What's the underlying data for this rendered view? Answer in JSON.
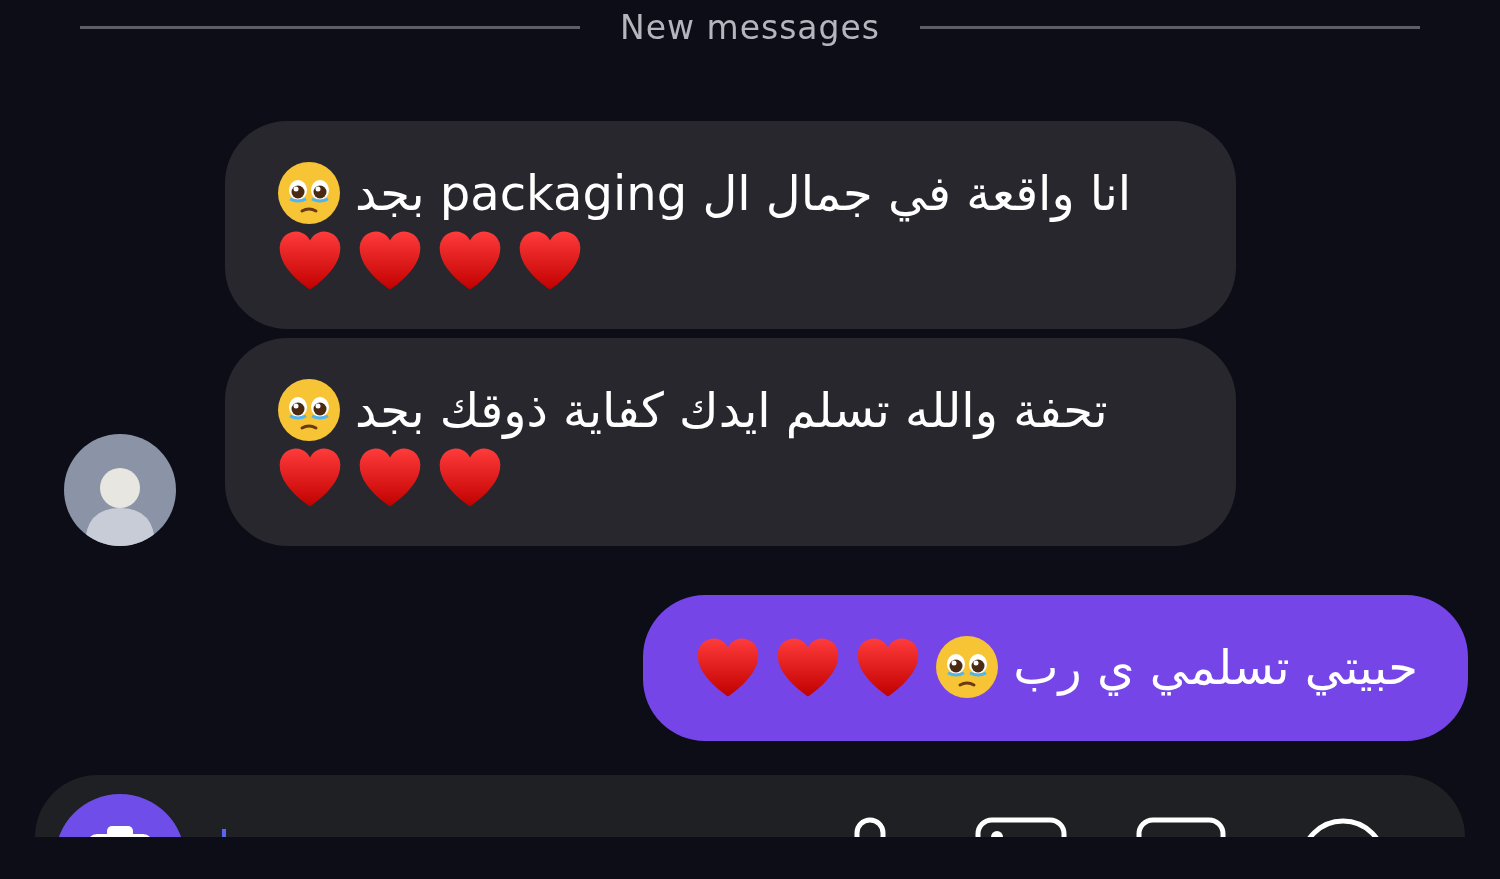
{
  "divider": {
    "label": "New messages"
  },
  "messages": [
    {
      "kind": "incoming",
      "show_avatar": false,
      "lines": [
        [
          {
            "kind": "text",
            "text": "انا واقعة في جمال ال packaging بجد"
          },
          {
            "kind": "pleading-face"
          }
        ],
        [
          {
            "kind": "heart"
          },
          {
            "kind": "heart"
          },
          {
            "kind": "heart"
          },
          {
            "kind": "heart"
          }
        ]
      ]
    },
    {
      "kind": "incoming",
      "show_avatar": true,
      "lines": [
        [
          {
            "kind": "text",
            "text": "تحفة والله تسلم ايدك كفاية ذوقك بجد"
          },
          {
            "kind": "pleading-face"
          }
        ],
        [
          {
            "kind": "heart"
          },
          {
            "kind": "heart"
          },
          {
            "kind": "heart"
          }
        ]
      ]
    },
    {
      "kind": "outgoing",
      "lines": [
        [
          {
            "kind": "text",
            "text": "حبيتي تسلمي ي رب"
          },
          {
            "kind": "pleading-face"
          },
          {
            "kind": "heart"
          },
          {
            "kind": "heart"
          },
          {
            "kind": "heart"
          }
        ]
      ]
    }
  ]
}
